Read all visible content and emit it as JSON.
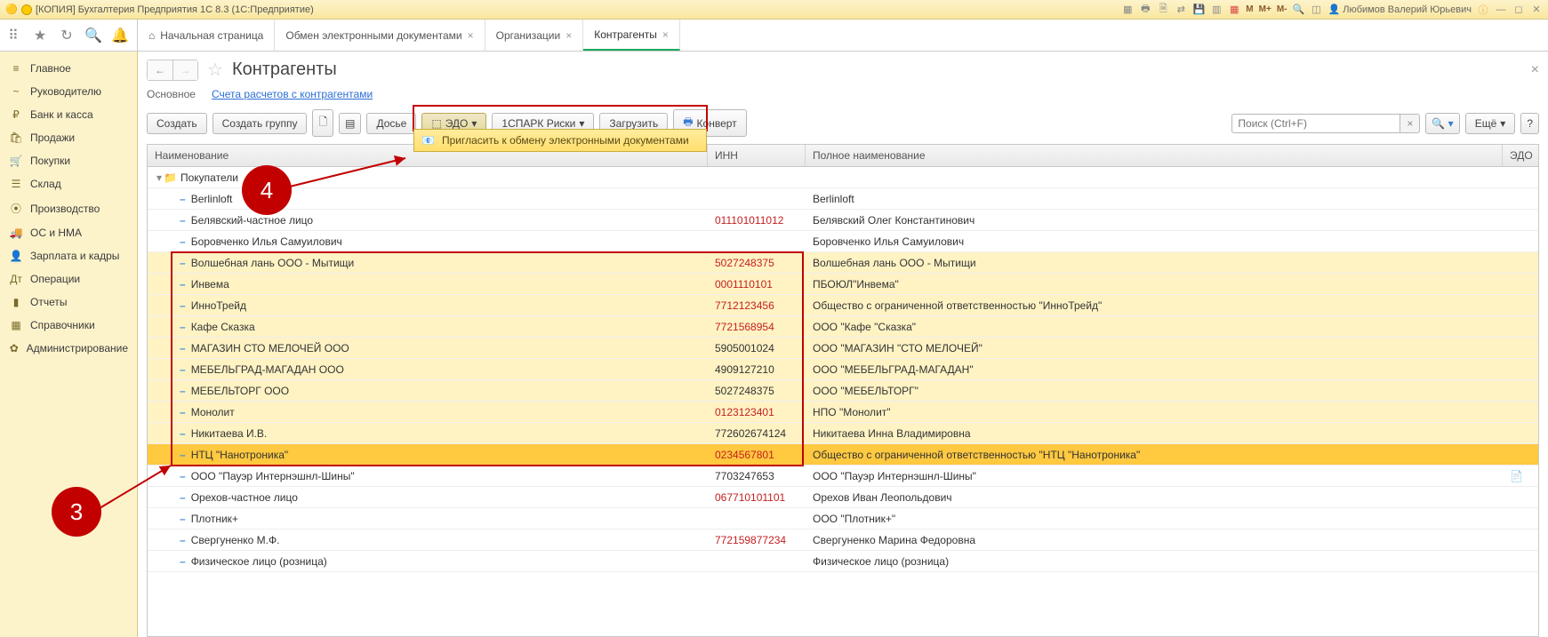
{
  "titlebar": {
    "app_title": "[КОПИЯ] Бухгалтерия Предприятия 1С 8.3  (1С:Предприятие)",
    "user": "Любимов Валерий Юрьевич",
    "m1": "M",
    "m2": "M+",
    "m3": "M-"
  },
  "toolbar": {
    "tabs": [
      {
        "label": "Начальная страница",
        "home": true,
        "closable": false
      },
      {
        "label": "Обмен электронными документами",
        "closable": true
      },
      {
        "label": "Организации",
        "closable": true
      },
      {
        "label": "Контрагенты",
        "closable": true,
        "active": true
      }
    ]
  },
  "sidebar": {
    "items": [
      {
        "icon": "≡",
        "label": "Главное"
      },
      {
        "icon": "~",
        "label": "Руководителю"
      },
      {
        "icon": "₽",
        "label": "Банк и касса"
      },
      {
        "icon": "🛍",
        "label": "Продажи"
      },
      {
        "icon": "🛒",
        "label": "Покупки"
      },
      {
        "icon": "☰",
        "label": "Склад"
      },
      {
        "icon": "⦿",
        "label": "Производство"
      },
      {
        "icon": "🚚",
        "label": "ОС и НМА"
      },
      {
        "icon": "👤",
        "label": "Зарплата и кадры"
      },
      {
        "icon": "Дт",
        "label": "Операции"
      },
      {
        "icon": "▮",
        "label": "Отчеты"
      },
      {
        "icon": "▦",
        "label": "Справочники"
      },
      {
        "icon": "✿",
        "label": "Администрирование"
      }
    ]
  },
  "page": {
    "title": "Контрагенты",
    "sub_main": "Основное",
    "sub_link": "Счета расчетов с контрагентами"
  },
  "actions": {
    "create": "Создать",
    "create_group": "Создать группу",
    "dossier": "Досье",
    "edo": "ЭДО",
    "spark": "1СПАРК Риски",
    "load": "Загрузить",
    "envelope": "Конверт",
    "search_placeholder": "Поиск (Ctrl+F)",
    "more": "Ещё",
    "dropdown_item": "Пригласить к обмену электронными документами"
  },
  "table": {
    "headers": {
      "name": "Наименование",
      "inn": "ИНН",
      "full": "Полное наименование",
      "edo": "ЭДО"
    },
    "group_label": "Покупатели",
    "rows": [
      {
        "name": "Berlinloft",
        "inn": "",
        "full": "Berlinloft",
        "sel": false
      },
      {
        "name": "Белявский-частное лицо",
        "inn": "011101011012",
        "inn_red": true,
        "full": "Белявский Олег Константинович",
        "sel": false
      },
      {
        "name": "Боровченко Илья Самуилович",
        "inn": "",
        "full": "Боровченко Илья Самуилович",
        "sel": false
      },
      {
        "name": "Волшебная лань ООО - Мытищи",
        "inn": "5027248375",
        "inn_red": true,
        "full": "Волшебная лань ООО - Мытищи",
        "sel": true
      },
      {
        "name": "Инвема",
        "inn": "0001110101",
        "inn_red": true,
        "full": "ПБОЮЛ\"Инвема\"",
        "sel": true
      },
      {
        "name": "ИнноТрейд",
        "inn": "7712123456",
        "inn_red": true,
        "full": "Общество с ограниченной ответственностью \"ИнноТрейд\"",
        "sel": true
      },
      {
        "name": "Кафе Сказка",
        "inn": "7721568954",
        "inn_red": true,
        "full": "ООО \"Кафе \"Сказка\"",
        "sel": true
      },
      {
        "name": "МАГАЗИН СТО МЕЛОЧЕЙ ООО",
        "inn": "5905001024",
        "full": "ООО \"МАГАЗИН \"СТО МЕЛОЧЕЙ\"",
        "sel": true
      },
      {
        "name": "МЕБЕЛЬГРАД-МАГАДАН ООО",
        "inn": "4909127210",
        "full": "ООО \"МЕБЕЛЬГРАД-МАГАДАН\"",
        "sel": true
      },
      {
        "name": "МЕБЕЛЬТОРГ ООО",
        "inn": "5027248375",
        "full": "ООО \"МЕБЕЛЬТОРГ\"",
        "sel": true
      },
      {
        "name": "Монолит",
        "inn": "0123123401",
        "inn_red": true,
        "full": "НПО \"Монолит\"",
        "sel": true
      },
      {
        "name": "Никитаева И.В.",
        "inn": "772602674124",
        "full": "Никитаева Инна Владимировна",
        "sel": true
      },
      {
        "name": "НТЦ \"Нанотроника\"",
        "inn": "0234567801",
        "inn_red": true,
        "full": "Общество с ограниченной ответственностью \"НТЦ \"Нанотроника\"",
        "sel": true,
        "cur": true
      },
      {
        "name": "ООО \"Пауэр Интернэшнл-Шины\"",
        "inn": "7703247653",
        "full": "ООО \"Пауэр Интернэшнл-Шины\"",
        "sel": false,
        "edo": true
      },
      {
        "name": "Орехов-частное лицо",
        "inn": "067710101101",
        "inn_red": true,
        "full": "Орехов Иван Леопольдович",
        "sel": false
      },
      {
        "name": "Плотник+",
        "inn": "",
        "full": "ООО \"Плотник+\"",
        "sel": false
      },
      {
        "name": "Свергуненко М.Ф.",
        "inn": "772159877234",
        "inn_red": true,
        "full": "Свергуненко Марина Федоровна",
        "sel": false
      },
      {
        "name": "Физическое лицо (розница)",
        "inn": "",
        "full": "Физическое лицо (розница)",
        "sel": false
      }
    ]
  },
  "callouts": {
    "c3": "3",
    "c4": "4"
  }
}
